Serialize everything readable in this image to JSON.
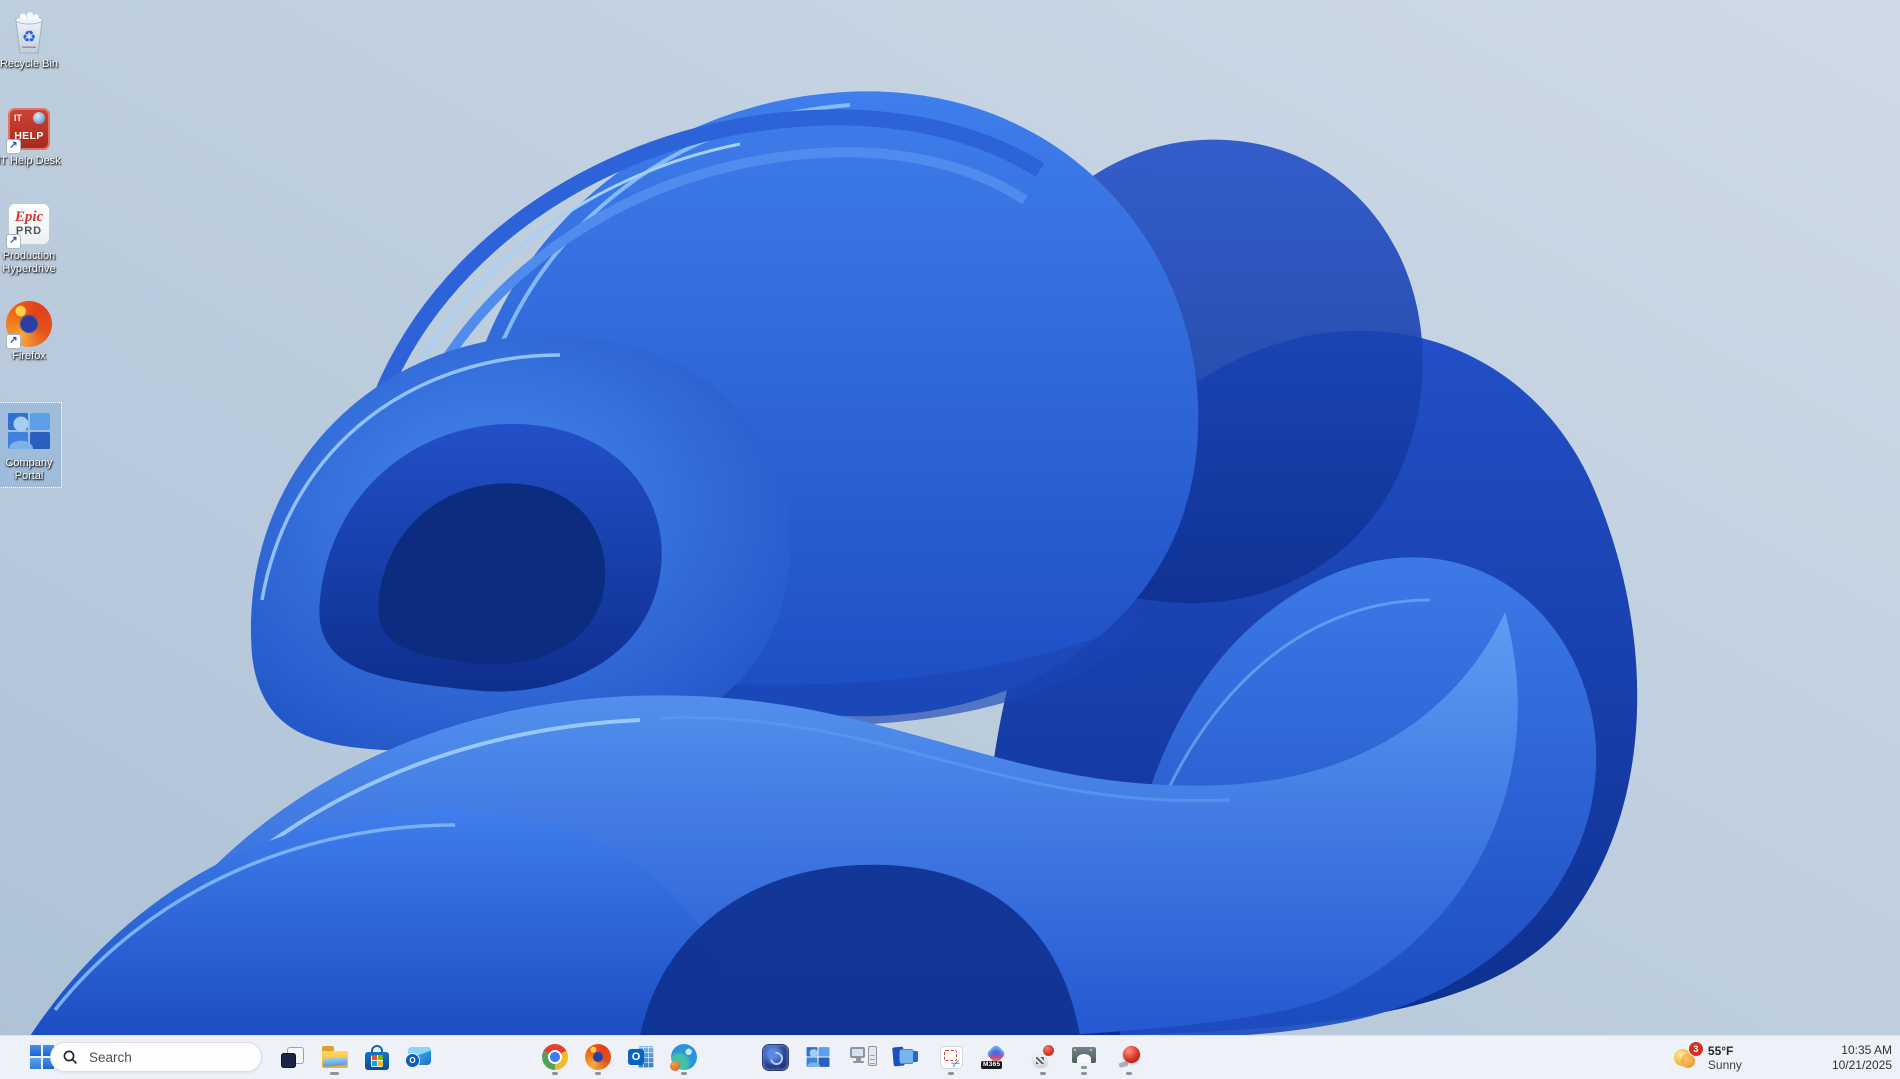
{
  "wallpaper": {
    "description": "Windows 11 blue bloom flower on light blue-gray background",
    "primary_blue": "#2e6fe6",
    "background_tint": "#c2d1e1"
  },
  "desktop": {
    "icons": [
      {
        "label": "Recycle Bin",
        "icon": "recycle-bin-icon",
        "selected": false,
        "shortcut": false
      },
      {
        "label": "IT Help Desk",
        "icon": "it-help-desk-icon",
        "selected": false,
        "shortcut": true,
        "art_line1": "IT",
        "art_line2": "HELP"
      },
      {
        "label": "Production Hyperdrive",
        "icon": "epic-prd-icon",
        "selected": false,
        "shortcut": true,
        "art_brand": "Epic",
        "art_tag": "PRD"
      },
      {
        "label": "Firefox",
        "icon": "firefox-icon",
        "selected": false,
        "shortcut": true
      },
      {
        "label": "Company Portal",
        "icon": "company-portal-icon",
        "selected": true,
        "shortcut": false
      }
    ]
  },
  "taskbar": {
    "search_placeholder": "Search",
    "apps": [
      {
        "name": "task-view",
        "running": false
      },
      {
        "name": "file-explorer",
        "running": true
      },
      {
        "name": "microsoft-store",
        "running": false
      },
      {
        "name": "outlook-new",
        "running": false
      },
      {
        "name": "chrome",
        "running": true
      },
      {
        "name": "firefox",
        "running": true
      },
      {
        "name": "outlook-classic",
        "running": false
      },
      {
        "name": "edge",
        "running": true
      },
      {
        "name": "epic-hyperdrive",
        "running": false
      },
      {
        "name": "company-portal",
        "running": false
      },
      {
        "name": "legacy-pc-app",
        "running": false
      },
      {
        "name": "remote-panels-app",
        "running": false
      },
      {
        "name": "snipping-tool",
        "running": true
      },
      {
        "name": "microsoft-365",
        "running": false
      },
      {
        "name": "red-balloon-app",
        "running": true
      },
      {
        "name": "monitor-app",
        "running": true
      },
      {
        "name": "red-sphere-app",
        "running": true
      }
    ],
    "m365_badge": "M365",
    "outlook_o": "O",
    "weather": {
      "badge_count": "3",
      "temperature": "55°F",
      "condition": "Sunny"
    },
    "clock": {
      "time": "10:35 AM",
      "date": "10/21/2025"
    }
  },
  "icons_glyphs": {
    "recycle": "♻",
    "scissors": "✂",
    "shortcut_arrow": "↗"
  }
}
